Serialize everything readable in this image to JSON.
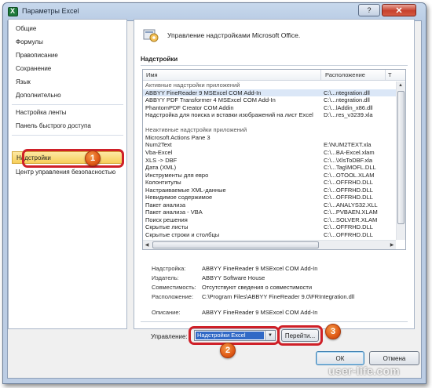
{
  "window": {
    "title": "Параметры Excel",
    "help": "?",
    "close": "✕"
  },
  "sidebar": {
    "items": [
      {
        "label": "Общие"
      },
      {
        "label": "Формулы"
      },
      {
        "label": "Правописание"
      },
      {
        "label": "Сохранение"
      },
      {
        "label": "Язык"
      },
      {
        "label": "Дополнительно"
      },
      {
        "label": "Настройка ленты"
      },
      {
        "label": "Панель быстрого доступа"
      },
      {
        "label": "Надстройки"
      },
      {
        "label": "Центр управления безопасностью"
      }
    ],
    "active_index": 8
  },
  "header": {
    "text": "Управление надстройками Microsoft Office."
  },
  "addins": {
    "section_label": "Надстройки",
    "columns": {
      "name": "Имя",
      "location": "Расположение",
      "type": "Т"
    },
    "rows": [
      {
        "name": "Активные надстройки приложений",
        "location": "",
        "group": true
      },
      {
        "name": "ABBYY FineReader 9 MSExcel COM Add-In",
        "location": "C:\\...ntegration.dll",
        "selected": true
      },
      {
        "name": "ABBYY PDF Transformer 4 MSExcel COM Add-In",
        "location": "C:\\...ntegration.dll"
      },
      {
        "name": "PhantomPDF Creator COM Addin",
        "location": "C:\\...lAddin_x86.dll"
      },
      {
        "name": "Надстройка для поиска и вставки изображений на лист Excel",
        "location": "D:\\...res_v3239.xla"
      },
      {
        "name": "",
        "location": "",
        "group": true
      },
      {
        "name": "Неактивные надстройки приложений",
        "location": "",
        "group": true
      },
      {
        "name": "Microsoft Actions Pane 3",
        "location": ""
      },
      {
        "name": "Num2Text",
        "location": "E:\\NUM2TEXT.xla"
      },
      {
        "name": "Vba-Excel",
        "location": "C:\\...BA-Excel.xlam"
      },
      {
        "name": "XLS -> DBF",
        "location": "C:\\...\\XlsToDBF.xla"
      },
      {
        "name": "Дата (XML)",
        "location": "C:\\...Tag\\MOFL.DLL"
      },
      {
        "name": "Инструменты для евро",
        "location": "C:\\...OTOOL.XLAM"
      },
      {
        "name": "Колонтитулы",
        "location": "C:\\...OFFRHD.DLL"
      },
      {
        "name": "Настраиваемые XML-данные",
        "location": "C:\\...OFFRHD.DLL"
      },
      {
        "name": "Невидимое содержимое",
        "location": "C:\\...OFFRHD.DLL"
      },
      {
        "name": "Пакет анализа",
        "location": "C:\\...ANALYS32.XLL"
      },
      {
        "name": "Пакет анализа - VBA",
        "location": "C:\\...PVBAEN.XLAM"
      },
      {
        "name": "Поиск решения",
        "location": "C:\\...SOLVER.XLAM"
      },
      {
        "name": "Скрытые листы",
        "location": "C:\\...OFFRHD.DLL"
      },
      {
        "name": "Скрытые строки и столбцы",
        "location": "C:\\...OFFRHD.DLL"
      }
    ]
  },
  "details": [
    {
      "key": "Надстройка:",
      "value": "ABBYY FineReader 9 MSExcel COM Add-In"
    },
    {
      "key": "Издатель:",
      "value": "ABBYY Software House"
    },
    {
      "key": "Совместимость:",
      "value": "Отсутствуют сведения о совместимости"
    },
    {
      "key": "Расположение:",
      "value": "C:\\Program Files\\ABBYY FineReader 9.0\\FRIntegration.dll"
    },
    {
      "key": "Описание:",
      "value": "ABBYY FineReader 9 MSExcel COM Add-In"
    }
  ],
  "manage": {
    "label": "Управление:",
    "selected": "Надстройки Excel",
    "go_label": "Перейти..."
  },
  "footer": {
    "ok": "ОК",
    "cancel": "Отмена"
  },
  "callouts": [
    "1",
    "2",
    "3"
  ],
  "watermark": "user-life.com",
  "colors": {
    "highlight": "#cf2028",
    "active_nav": "#f7cf5a",
    "selection": "#3169c6",
    "badge": "#e05a16"
  }
}
